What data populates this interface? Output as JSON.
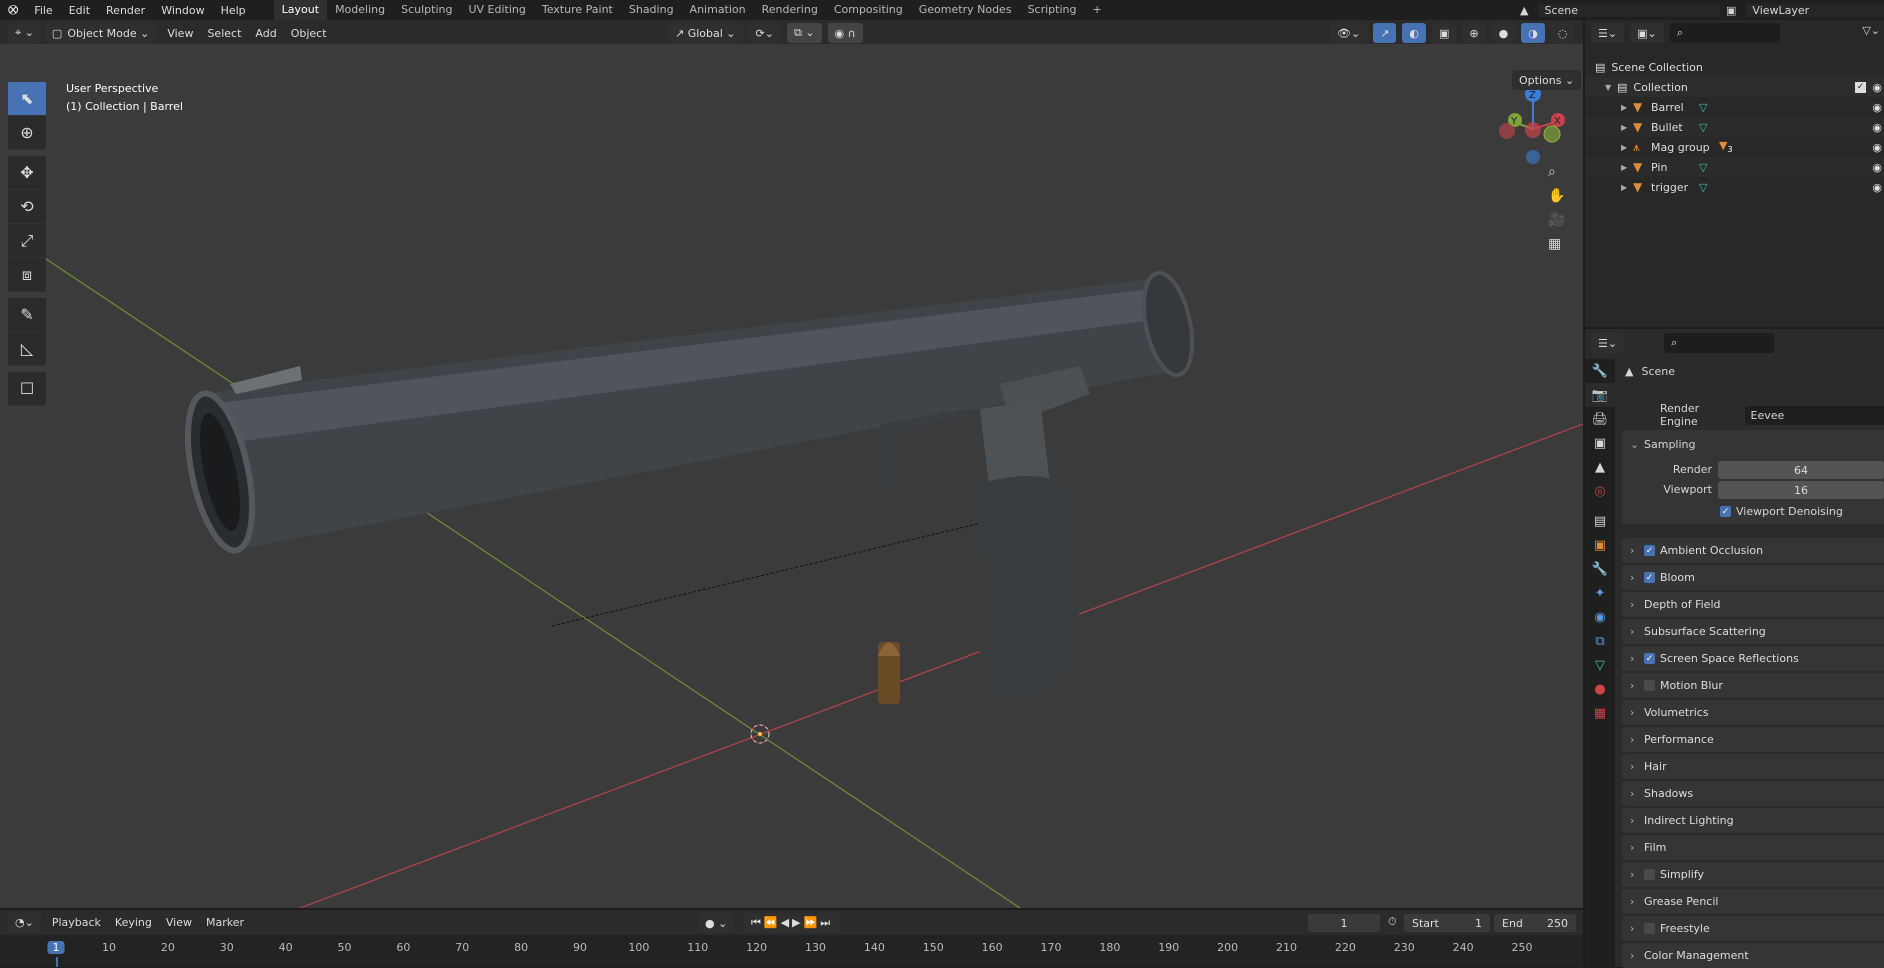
{
  "topbar": {
    "menus": [
      "File",
      "Edit",
      "Render",
      "Window",
      "Help"
    ],
    "workspaces": [
      "Layout",
      "Modeling",
      "Sculpting",
      "UV Editing",
      "Texture Paint",
      "Shading",
      "Animation",
      "Rendering",
      "Compositing",
      "Geometry Nodes",
      "Scripting"
    ],
    "add_tab": "+",
    "scene": "Scene",
    "view_layer": "ViewLayer"
  },
  "viewport_header": {
    "mode": "Object Mode",
    "menus": [
      "View",
      "Select",
      "Add",
      "Object"
    ],
    "orientation": "Global",
    "options": "Options"
  },
  "viewport": {
    "perspective": "User Perspective",
    "context": "(1) Collection | Barrel",
    "gizmo": {
      "z": "Z",
      "y": "Y",
      "x": "X"
    }
  },
  "outliner": {
    "root": "Scene Collection",
    "collection": "Collection",
    "items": [
      {
        "name": "Barrel"
      },
      {
        "name": "Bullet"
      },
      {
        "name": "Mag group",
        "badge": "3"
      },
      {
        "name": "Pin"
      },
      {
        "name": "trigger"
      }
    ]
  },
  "properties": {
    "context": "Scene",
    "render_engine_label": "Render Engine",
    "render_engine": "Eevee",
    "sampling": {
      "title": "Sampling",
      "render_label": "Render",
      "render": "64",
      "viewport_label": "Viewport",
      "viewport": "16",
      "denoise": "Viewport Denoising"
    },
    "panels": [
      {
        "label": "Ambient Occlusion",
        "check": true
      },
      {
        "label": "Bloom",
        "check": true
      },
      {
        "label": "Depth of Field"
      },
      {
        "label": "Subsurface Scattering"
      },
      {
        "label": "Screen Space Reflections",
        "check": true
      },
      {
        "label": "Motion Blur",
        "check": false
      },
      {
        "label": "Volumetrics"
      },
      {
        "label": "Performance"
      },
      {
        "label": "Hair"
      },
      {
        "label": "Shadows"
      },
      {
        "label": "Indirect Lighting"
      },
      {
        "label": "Film"
      },
      {
        "label": "Simplify",
        "check": false
      },
      {
        "label": "Grease Pencil"
      },
      {
        "label": "Freestyle",
        "check": false
      },
      {
        "label": "Color Management"
      }
    ]
  },
  "timeline": {
    "menus": [
      "Playback",
      "Keying",
      "View",
      "Marker"
    ],
    "current_frame": "1",
    "start_label": "Start",
    "start": "1",
    "end_label": "End",
    "end": "250",
    "ticks": [
      "1",
      "10",
      "20",
      "30",
      "40",
      "50",
      "60",
      "70",
      "80",
      "90",
      "100",
      "110",
      "120",
      "130",
      "140",
      "150",
      "160",
      "170",
      "180",
      "190",
      "200",
      "210",
      "220",
      "230",
      "240",
      "250"
    ]
  },
  "colors": {
    "accent": "#4772b3",
    "x_axis": "#c9434c",
    "y_axis": "#7ea33b",
    "z_axis": "#3d7fd6"
  }
}
